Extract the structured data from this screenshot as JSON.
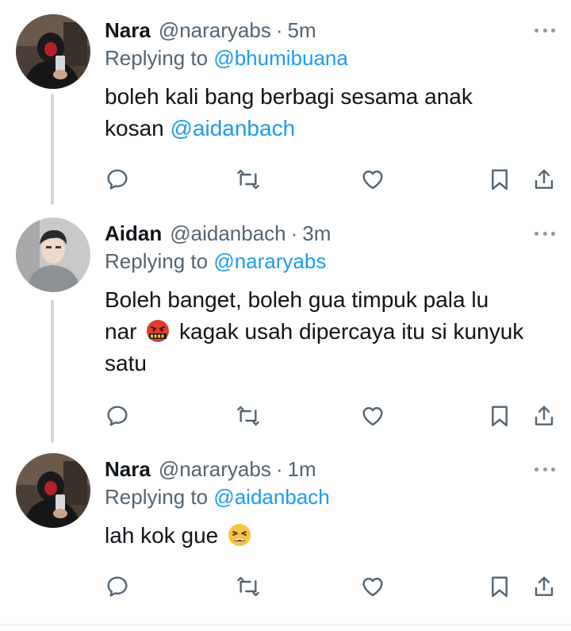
{
  "colors": {
    "text_primary": "#0f1419",
    "text_secondary": "#536471",
    "mention": "#1d9bf0",
    "thread_line": "#cfd9de",
    "icon": "#536471"
  },
  "tweets": [
    {
      "name": "Nara",
      "handle": "@nararyabs",
      "separator": "·",
      "time": "5m",
      "replying_prefix": "Replying to",
      "replying_to": "@bhumibuana",
      "body_line1": "boleh kali bang berbagi sesama anak",
      "body_line2_text": "kosan",
      "body_line2_mention": "@aidanbach",
      "avatar_icon": "avatar-hooded-person",
      "actions": [
        "reply-icon",
        "retweet-icon",
        "like-icon",
        "bookmark-icon",
        "share-icon"
      ]
    },
    {
      "name": "Aidan",
      "handle": "@aidanbach",
      "separator": "·",
      "time": "3m",
      "replying_prefix": "Replying to",
      "replying_to": "@nararyabs",
      "body_line1": "Boleh banget, boleh gua timpuk pala lu",
      "body_line2_pre": "nar",
      "body_line2_emoji": "cursing-face-emoji",
      "body_line2_post": "kagak usah dipercaya itu si kunyuk",
      "body_line3": "satu",
      "avatar_icon": "avatar-person-grey-hoodie",
      "actions": [
        "reply-icon",
        "retweet-icon",
        "like-icon",
        "bookmark-icon",
        "share-icon"
      ]
    },
    {
      "name": "Nara",
      "handle": "@nararyabs",
      "separator": "·",
      "time": "1m",
      "replying_prefix": "Replying to",
      "replying_to": "@aidanbach",
      "body_line1_text": "lah kok gue",
      "body_line1_emoji": "tired-face-emoji",
      "avatar_icon": "avatar-hooded-person",
      "actions": [
        "reply-icon",
        "retweet-icon",
        "like-icon",
        "bookmark-icon",
        "share-icon"
      ]
    }
  ]
}
